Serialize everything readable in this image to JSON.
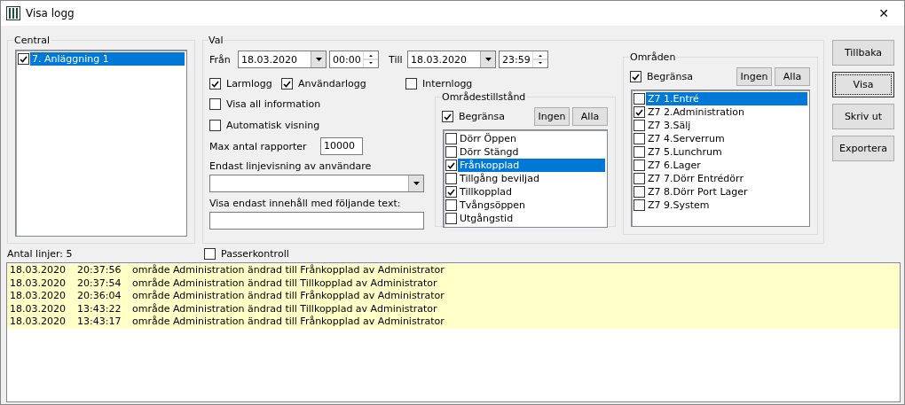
{
  "window": {
    "title": "Visa logg",
    "close": "✕"
  },
  "central": {
    "title": "Central",
    "items": [
      {
        "label": "7. Anläggning 1",
        "checked": true,
        "selected": true
      }
    ]
  },
  "val": {
    "title": "Val",
    "from": {
      "label": "Från",
      "date": "18.03.2020",
      "time": "00:00"
    },
    "to": {
      "label": "Till",
      "date": "18.03.2020",
      "time": "23:59"
    },
    "logs": [
      {
        "label": "Larmlogg",
        "checked": true
      },
      {
        "label": "Användarlogg",
        "checked": true
      },
      {
        "label": "Internlogg",
        "checked": false
      }
    ],
    "options": [
      {
        "label": "Visa all information",
        "checked": false
      },
      {
        "label": "Automatisk visning",
        "checked": false
      }
    ],
    "max_label": "Max antal rapporter",
    "max_value": "10000",
    "user_label": "Endast linjevisning av användare",
    "text_label": "Visa endast innehåll med följande text:"
  },
  "omradestillstand": {
    "title": "Områdestillstånd",
    "limit": {
      "label": "Begränsa",
      "checked": true
    },
    "buttons": [
      "Ingen",
      "Alla"
    ],
    "items": [
      {
        "label": "Dörr Öppen",
        "checked": false,
        "selected": false
      },
      {
        "label": "Dörr Stängd",
        "checked": false,
        "selected": false
      },
      {
        "label": "Frånkopplad",
        "checked": true,
        "selected": true
      },
      {
        "label": "Tillgång beviljad",
        "checked": false,
        "selected": false
      },
      {
        "label": "Tillkopplad",
        "checked": true,
        "selected": false
      },
      {
        "label": "Tvångsöppen",
        "checked": false,
        "selected": false
      },
      {
        "label": "Utgångstid",
        "checked": false,
        "selected": false
      }
    ]
  },
  "omraden": {
    "title": "Områden",
    "limit": {
      "label": "Begränsa",
      "checked": true
    },
    "buttons": [
      "Ingen",
      "Alla"
    ],
    "items": [
      {
        "label": "Z7 1.Entré",
        "checked": false,
        "selected": true
      },
      {
        "label": "Z7 2.Administration",
        "checked": true,
        "selected": false
      },
      {
        "label": "Z7 3.Sälj",
        "checked": false,
        "selected": false
      },
      {
        "label": "Z7 4.Serverrum",
        "checked": false,
        "selected": false
      },
      {
        "label": "Z7 5.Lunchrum",
        "checked": false,
        "selected": false
      },
      {
        "label": "Z7 6.Lager",
        "checked": false,
        "selected": false
      },
      {
        "label": "Z7 7.Dörr Entrédörr",
        "checked": false,
        "selected": false
      },
      {
        "label": "Z7 8.Dörr Port Lager",
        "checked": false,
        "selected": false
      },
      {
        "label": "Z7 9.System",
        "checked": false,
        "selected": false
      }
    ]
  },
  "buttons": [
    {
      "label": "Tillbaka",
      "focused": false
    },
    {
      "label": "Visa",
      "focused": true
    },
    {
      "label": "Skriv ut",
      "focused": false
    },
    {
      "label": "Exportera",
      "focused": false
    }
  ],
  "line_count": "Antal linjer: 5",
  "passerkontroll": {
    "label": "Passerkontroll",
    "checked": false
  },
  "log": [
    {
      "date": "18.03.2020",
      "time": "20:37:56",
      "text": "område Administration ändrad till Frånkopplad av Administrator"
    },
    {
      "date": "18.03.2020",
      "time": "20:37:54",
      "text": "område Administration ändrad till Tillkopplad av Administrator"
    },
    {
      "date": "18.03.2020",
      "time": "20:36:04",
      "text": "område Administration ändrad till Frånkopplad av Administrator"
    },
    {
      "date": "18.03.2020",
      "time": "13:43:22",
      "text": "område Administration ändrad till Tillkopplad av Administrator"
    },
    {
      "date": "18.03.2020",
      "time": "13:43:17",
      "text": "område Administration ändrad till Frånkopplad av Administrator"
    }
  ]
}
